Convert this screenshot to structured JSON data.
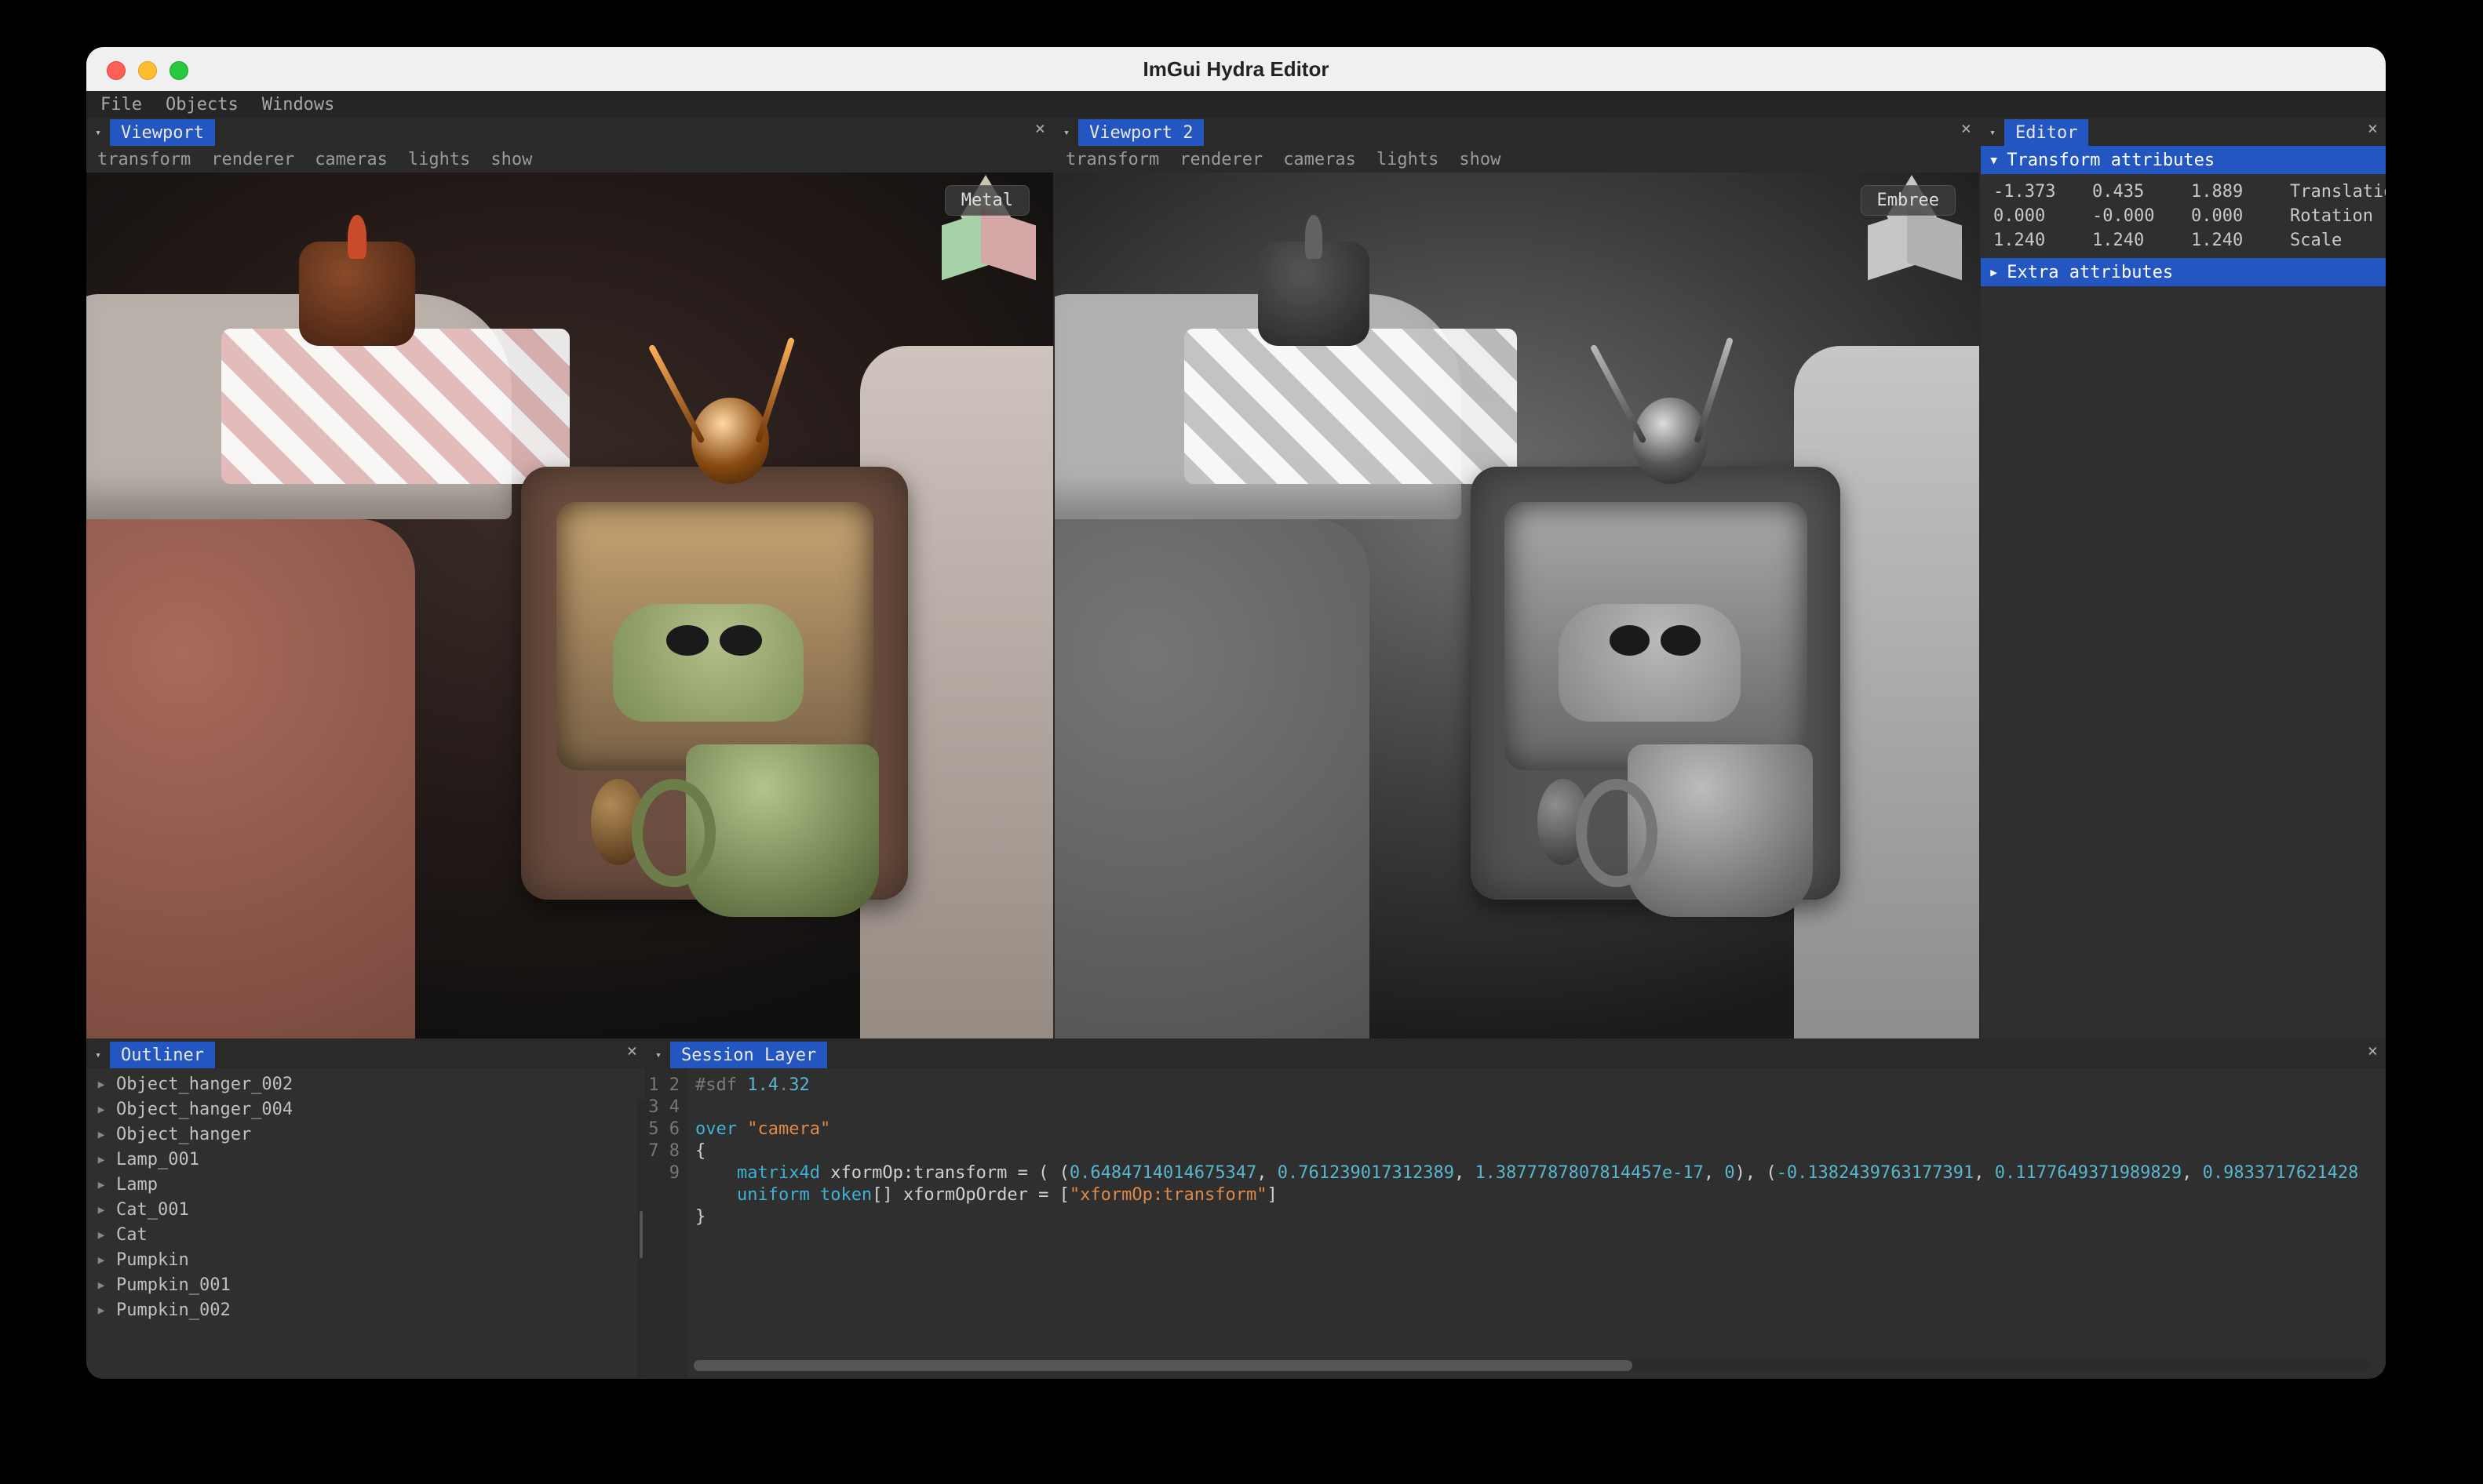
{
  "window": {
    "title": "ImGui Hydra Editor"
  },
  "menubar": [
    "File",
    "Objects",
    "Windows"
  ],
  "viewport1": {
    "tab": "Viewport",
    "toolbar": [
      "transform",
      "renderer",
      "cameras",
      "lights",
      "show"
    ],
    "badge": "Metal"
  },
  "viewport2": {
    "tab": "Viewport 2",
    "toolbar": [
      "transform",
      "renderer",
      "cameras",
      "lights",
      "show"
    ],
    "badge": "Embree"
  },
  "editor": {
    "tab": "Editor",
    "sections": {
      "transform": {
        "title": "Transform attributes",
        "rows": [
          {
            "a": "-1.373",
            "b": "0.435",
            "c": "1.889",
            "label": "Translation"
          },
          {
            "a": "0.000",
            "b": "-0.000",
            "c": "0.000",
            "label": "Rotation"
          },
          {
            "a": "1.240",
            "b": "1.240",
            "c": "1.240",
            "label": "Scale"
          }
        ]
      },
      "extra": {
        "title": "Extra attributes"
      }
    }
  },
  "outliner": {
    "tab": "Outliner",
    "items": [
      "Object_hanger_002",
      "Object_hanger_004",
      "Object_hanger",
      "Lamp_001",
      "Lamp",
      "Cat_001",
      "Cat",
      "Pumpkin",
      "Pumpkin_001",
      "Pumpkin_002"
    ]
  },
  "session": {
    "tab": "Session Layer",
    "lines": [
      "#sdf 1.4.32",
      "",
      "over \"camera\"",
      "{",
      "    matrix4d xformOp:transform = ( (0.6484714014675347, 0.761239017312389, 1.3877787807814457e-17, 0), (-0.1382439763177391, 0.1177649371989829, 0.9833717621428",
      "    uniform token[] xformOpOrder = [\"xformOp:transform\"]",
      "}",
      "",
      ""
    ]
  }
}
